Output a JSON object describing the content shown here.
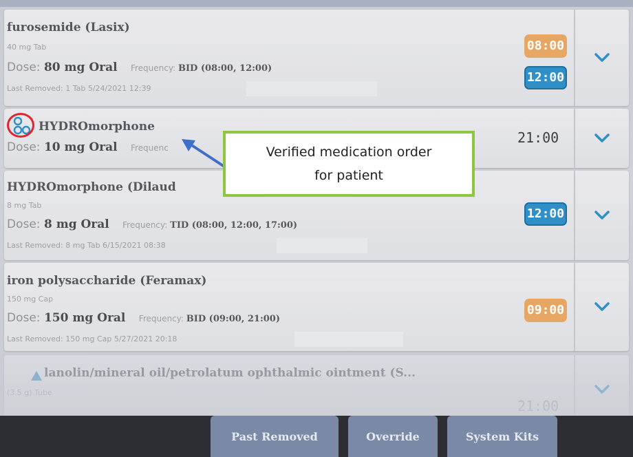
{
  "colors": {
    "badge_orange": "#e6a764",
    "badge_blue": "#2f8fc6",
    "chevron_blue": "#2f8fc6",
    "verified_icon": "#2f8fc6",
    "callout_border": "#8dc63f",
    "annotation_ring": "#e3242b",
    "annotation_arrow": "#3f6fc9"
  },
  "medications": [
    {
      "name": "furosemide (Lasix)",
      "form": "40 mg Tab",
      "dose_label": "Dose:",
      "dose_value": "80 mg Oral",
      "frequency_label": "Frequency:",
      "frequency_value": "BID (08:00, 12:00)",
      "last_removed": "Last Removed: 1 Tab 5/24/2021 12:39",
      "times": [
        "08:00",
        "12:00"
      ]
    },
    {
      "name": "HYDROmorphone",
      "icon": "verified-order-icon",
      "dose_label": "Dose:",
      "dose_value": "10 mg Oral",
      "frequency_label": "Frequenc",
      "time": "21:00"
    },
    {
      "name": "HYDROmorphone (Dilaud",
      "form": "8 mg Tab",
      "dose_label": "Dose:",
      "dose_value": "8 mg Oral",
      "frequency_label": "Frequency:",
      "frequency_value": "TID (08:00, 12:00, 17:00)",
      "last_removed": "Last Removed: 8 mg Tab 6/15/2021 08:38",
      "time": "12:00"
    },
    {
      "name": "iron polysaccharide (Feramax)",
      "form": "150 mg Cap",
      "dose_label": "Dose:",
      "dose_value": "150 mg Oral",
      "frequency_label": "Frequency:",
      "frequency_value": "BID (09:00, 21:00)",
      "last_removed": "Last Removed: 150 mg Cap 5/27/2021 20:18",
      "time": "09:00"
    },
    {
      "name": "lanolin/mineral oil/petrolatum ophthalmic ointment (S...",
      "icon": "warning-triangle-icon",
      "form": "(3.5 g) Tube",
      "time": "21:00"
    }
  ],
  "callout": {
    "line1": "Verified medication order",
    "line2": "for patient"
  },
  "bottom_buttons": [
    "Past Removed",
    "Override",
    "System Kits"
  ]
}
